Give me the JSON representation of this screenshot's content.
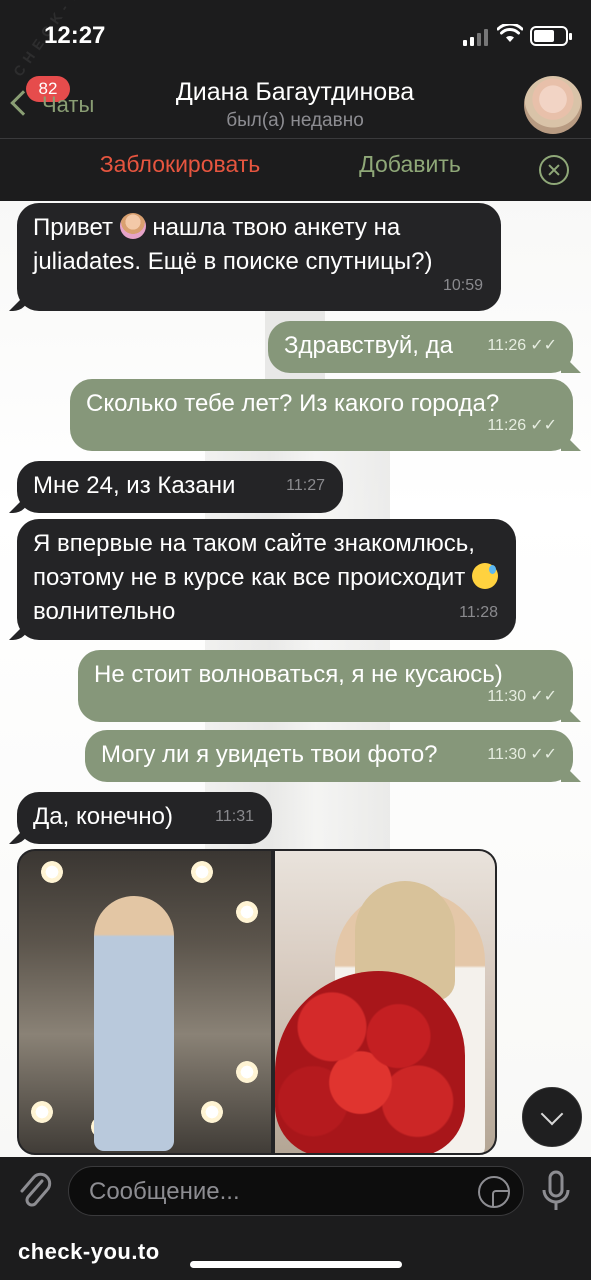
{
  "status_bar": {
    "time": "12:27"
  },
  "header": {
    "badge_count": "82",
    "back_label": "Чаты",
    "contact_name": "Диана Багаутдинова",
    "contact_status": "был(а) недавно"
  },
  "action_bar": {
    "block_label": "Заблокировать",
    "add_label": "Добавить"
  },
  "messages": [
    {
      "direction": "in",
      "text_before": "Привет",
      "text_after": "нашла твою анкету на juliadates. Ещё в поиске спутницы?)",
      "time": "10:59"
    },
    {
      "direction": "out",
      "text": "Здравствуй, да",
      "time": "11:26"
    },
    {
      "direction": "out",
      "text": "Сколько тебе лет? Из какого города?",
      "time": "11:26"
    },
    {
      "direction": "in",
      "text": "Мне 24, из Казани",
      "time": "11:27"
    },
    {
      "direction": "in",
      "text_before": "Я впервые на таком сайте знакомлюсь, поэтому не в курсе как все происходит",
      "text_after": "волнительно",
      "time": "11:28"
    },
    {
      "direction": "out",
      "text": "Не стоит волноваться, я не кусаюсь)",
      "time": "11:30"
    },
    {
      "direction": "out",
      "text": "Могу ли я увидеть твои фото?",
      "time": "11:30"
    },
    {
      "direction": "in",
      "text": "Да, конечно)",
      "time": "11:31"
    }
  ],
  "input": {
    "placeholder": "Сообщение..."
  },
  "footer": {
    "site_label": "check-you.to"
  },
  "watermark": {
    "text": "CHECK-YOU.ME"
  },
  "colors": {
    "accent_green": "#86977a",
    "danger_red": "#e6553f",
    "header_bg": "#1c1c1d",
    "incoming_bubble": "#242426"
  },
  "icons": [
    "back-chevron-icon",
    "signal-icon",
    "wifi-icon",
    "battery-icon",
    "close-icon",
    "double-check-icon",
    "scroll-down-icon",
    "attach-icon",
    "sticker-icon",
    "mic-icon"
  ]
}
